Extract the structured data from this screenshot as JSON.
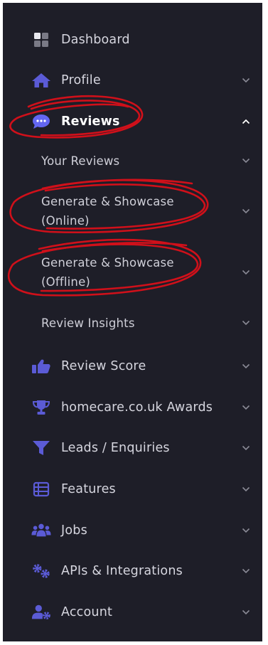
{
  "menu": [
    {
      "label": "Dashboard",
      "icon": "dashboard-icon",
      "has_chevron": false
    },
    {
      "label": "Profile",
      "icon": "home-icon",
      "has_chevron": true
    },
    {
      "label": "Reviews",
      "icon": "chat-icon",
      "has_chevron": true,
      "expanded": true
    },
    {
      "label": "Review Score",
      "icon": "thumbs-up-icon",
      "has_chevron": true
    },
    {
      "label": "homecare.co.uk Awards",
      "icon": "trophy-icon",
      "has_chevron": true
    },
    {
      "label": "Leads / Enquiries",
      "icon": "funnel-icon",
      "has_chevron": true
    },
    {
      "label": "Features",
      "icon": "list-icon",
      "has_chevron": true
    },
    {
      "label": "Jobs",
      "icon": "users-icon",
      "has_chevron": true
    },
    {
      "label": "APIs & Integrations",
      "icon": "gears-icon",
      "has_chevron": true
    },
    {
      "label": "Account",
      "icon": "user-cog-icon",
      "has_chevron": true
    }
  ],
  "reviews_submenu": [
    {
      "label": "Your Reviews"
    },
    {
      "label": "Generate & Showcase\n(Online)"
    },
    {
      "label": "Generate & Showcase\n(Offline)"
    },
    {
      "label": "Review Insights"
    }
  ],
  "colors": {
    "sidebar_bg": "#1e1e28",
    "icon": "#5b5bd6",
    "chat_icon": "#6366f1",
    "text": "#d6d6df",
    "annotation": "#d0101a"
  }
}
